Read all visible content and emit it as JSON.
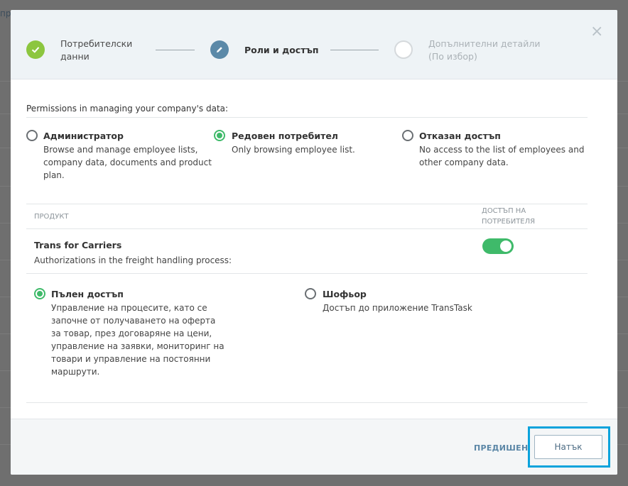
{
  "background": {
    "fragment": "пр"
  },
  "stepper": {
    "steps": [
      {
        "label_line1": "Потребителски",
        "label_line2": "данни",
        "state": "done"
      },
      {
        "label_line1": "Роли и достъп",
        "label_line2": "",
        "state": "active"
      },
      {
        "label_line1": "Допълнителни детайли",
        "label_line2": "(По избор)",
        "state": "future"
      }
    ]
  },
  "permissions": {
    "title": "Permissions in managing your company's data:",
    "selected": "regular",
    "options": [
      {
        "id": "admin",
        "title": "Администратор",
        "desc": [
          "Browse and manage employee lists,",
          "company data, documents and product",
          "plan."
        ]
      },
      {
        "id": "regular",
        "title": "Редовен потребител",
        "desc": [
          "Only browsing employee list."
        ]
      },
      {
        "id": "denied",
        "title": "Отказан достъп",
        "desc": [
          "No access to the list of employees and",
          "other company data."
        ]
      }
    ]
  },
  "products_table": {
    "col_product": "ПРОДУКТ",
    "col_access_line1": "ДОСТЪП НА",
    "col_access_line2": "ПОТРЕБИТЕЛЯ",
    "product": {
      "name": "Trans for Carriers",
      "subtitle": "Authorizations in the freight handling process:",
      "access_enabled": true,
      "selected": "full",
      "options": [
        {
          "id": "full",
          "title": "Пълен достъп",
          "desc": [
            "Управление на процесите, като се",
            "започне от получаването на оферта",
            "за товар, през договаряне на цени,",
            "управление на заявки, мониторинг на",
            "товари и управление на постоянни",
            "маршрути."
          ]
        },
        {
          "id": "driver",
          "title": "Шофьор",
          "desc": [
            "Достъп до приложение TransTask"
          ]
        }
      ]
    }
  },
  "footer": {
    "prev_label": "ПРЕДИШЕН",
    "next_label": "Натък"
  },
  "colors": {
    "accent_green": "#3fba6a",
    "step_done": "#8cc63f",
    "step_active": "#5b89a8",
    "focus": "#0aa3dc"
  }
}
